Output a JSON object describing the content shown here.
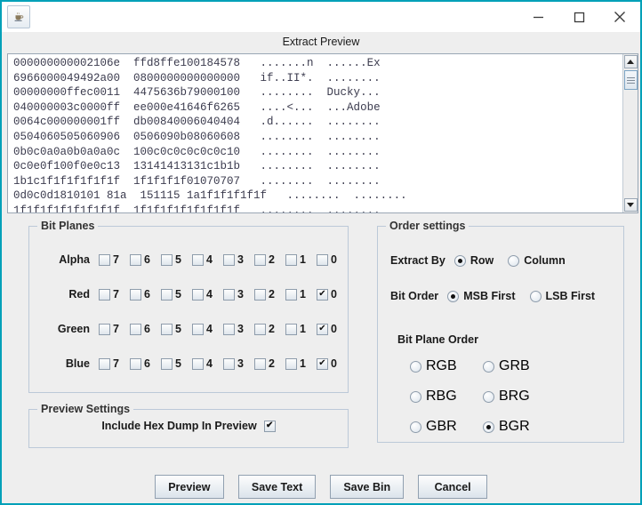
{
  "window": {
    "app_icon": "java-coffee-cup-icon",
    "caption": "Extract Preview",
    "minimize_label": "−",
    "maximize_label": "□",
    "close_label": "×"
  },
  "hexdump": {
    "lines": [
      "000000000002106e  ffd8ffe100184578   .......n  ......Ex",
      "6966000049492a00  0800000000000000   if..II*.  ........",
      "00000000ffec0011  4475636b79000100   ........  Ducky...",
      "040000003c0000ff  ee000e41646f6265   ....<...  ...Adobe",
      "0064c000000001ff  db00840006040404   .d......  ........",
      "0504060505060906  0506090b08060608   ........  ........",
      "0b0c0a0a0b0a0a0c  100c0c0c0c0c0c10   ........  ........",
      "0c0e0f100f0e0c13  13141413131c1b1b   ........  ........",
      "1b1c1f1f1f1f1f1f  1f1f1f1f01070707   ........  ........",
      "0d0c0d1810101 81a  151115 1a1f1f1f1f1f   ........  ........",
      "1f1f1f1f1f1f1f1f  1f1f1f1f1f1f1f1f   ........  ........"
    ]
  },
  "bit_planes": {
    "title": "Bit Planes",
    "bits": [
      "7",
      "6",
      "5",
      "4",
      "3",
      "2",
      "1",
      "0"
    ],
    "rows": [
      {
        "label": "Alpha",
        "checked": [
          false,
          false,
          false,
          false,
          false,
          false,
          false,
          false
        ]
      },
      {
        "label": "Red",
        "checked": [
          false,
          false,
          false,
          false,
          false,
          false,
          false,
          true
        ]
      },
      {
        "label": "Green",
        "checked": [
          false,
          false,
          false,
          false,
          false,
          false,
          false,
          true
        ]
      },
      {
        "label": "Blue",
        "checked": [
          false,
          false,
          false,
          false,
          false,
          false,
          false,
          true
        ]
      }
    ]
  },
  "order_settings": {
    "title": "Order settings",
    "extract_by_label": "Extract By",
    "extract_by_options": [
      "Row",
      "Column"
    ],
    "extract_by_selected": "Row",
    "bit_order_label": "Bit Order",
    "bit_order_options": [
      "MSB First",
      "LSB First"
    ],
    "bit_order_selected": "MSB First",
    "bit_plane_order_label": "Bit Plane Order",
    "bit_plane_order_options": [
      "RGB",
      "GRB",
      "RBG",
      "BRG",
      "GBR",
      "BGR"
    ],
    "bit_plane_order_selected": "BGR"
  },
  "preview_settings": {
    "title": "Preview Settings",
    "include_hex_dump_label": "Include Hex Dump In Preview",
    "include_hex_dump_checked": true
  },
  "buttons": [
    {
      "label": "Preview"
    },
    {
      "label": "Save Text"
    },
    {
      "label": "Save Bin"
    },
    {
      "label": "Cancel"
    }
  ],
  "colors": {
    "window_border": "#00a0b8",
    "panel_bg": "#eeeeee",
    "hex_text": "#3b3b4e"
  }
}
